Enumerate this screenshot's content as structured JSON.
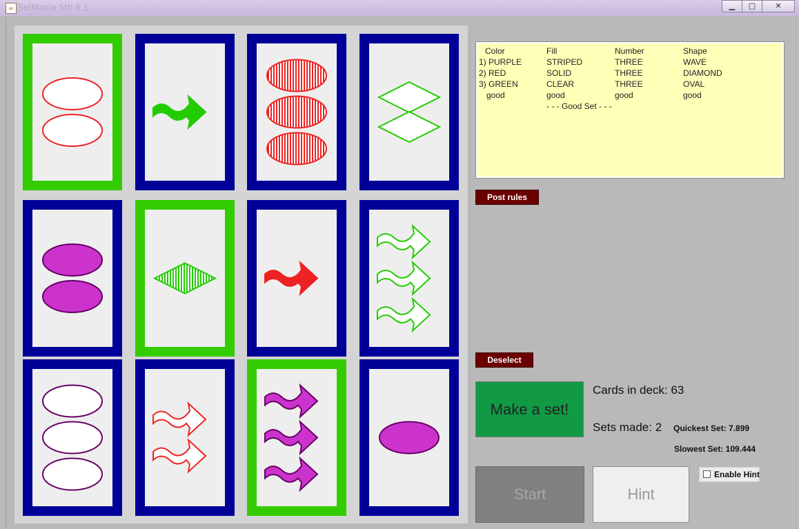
{
  "window": {
    "title": "SetMania 5th 6.1",
    "minimize_icon": "minimize-icon",
    "maximize_icon": "maximize-icon",
    "close_icon": "close-icon"
  },
  "cards": [
    {
      "color": "red",
      "fill": "clear",
      "number": 2,
      "shape": "oval",
      "selected": true
    },
    {
      "color": "green",
      "fill": "solid",
      "number": 1,
      "shape": "wave",
      "selected": false
    },
    {
      "color": "red",
      "fill": "striped",
      "number": 3,
      "shape": "oval",
      "selected": false
    },
    {
      "color": "green",
      "fill": "clear",
      "number": 2,
      "shape": "diamond",
      "selected": false
    },
    {
      "color": "purple",
      "fill": "solid",
      "number": 2,
      "shape": "oval",
      "selected": false
    },
    {
      "color": "green",
      "fill": "striped",
      "number": 1,
      "shape": "diamond",
      "selected": true
    },
    {
      "color": "red",
      "fill": "solid",
      "number": 1,
      "shape": "wave",
      "selected": false
    },
    {
      "color": "green",
      "fill": "clear",
      "number": 3,
      "shape": "wave",
      "selected": false
    },
    {
      "color": "purple",
      "fill": "clear",
      "number": 3,
      "shape": "oval",
      "selected": false
    },
    {
      "color": "red",
      "fill": "clear",
      "number": 2,
      "shape": "wave",
      "selected": false
    },
    {
      "color": "purple",
      "fill": "solid",
      "number": 3,
      "shape": "wave",
      "selected": true
    },
    {
      "color": "purple",
      "fill": "solid",
      "number": 1,
      "shape": "oval",
      "selected": false
    }
  ],
  "colors": {
    "red": "#ee2222",
    "green": "#22cc00",
    "purple": "#cc33cc",
    "purple_stroke": "#660066",
    "card_border": "#000099",
    "card_selected_border": "#33cc00"
  },
  "rules_panel": {
    "headers": [
      "Color",
      "Fill",
      "Number",
      "Shape"
    ],
    "rows": [
      [
        "1) PURPLE",
        "STRIPED",
        "THREE",
        "WAVE"
      ],
      [
        "2) RED",
        "SOLID",
        "THREE",
        "DIAMOND"
      ],
      [
        "3) GREEN",
        "CLEAR",
        "THREE",
        "OVAL"
      ],
      [
        "good",
        "good",
        "good",
        "good"
      ]
    ],
    "verdict": "- - - Good Set - - -"
  },
  "buttons": {
    "post_rules": "Post rules",
    "deselect": "Deselect",
    "make_set": "Make a set!",
    "start": "Start",
    "hint": "Hint",
    "enable_hint": "Enable Hint"
  },
  "enable_hint_checked": false,
  "stats": {
    "cards_in_deck": "Cards in deck: 63",
    "sets_made": "Sets made: 2",
    "quickest_set": "Quickest Set: 7.899",
    "slowest_set": "Slowest Set: 109.444"
  }
}
